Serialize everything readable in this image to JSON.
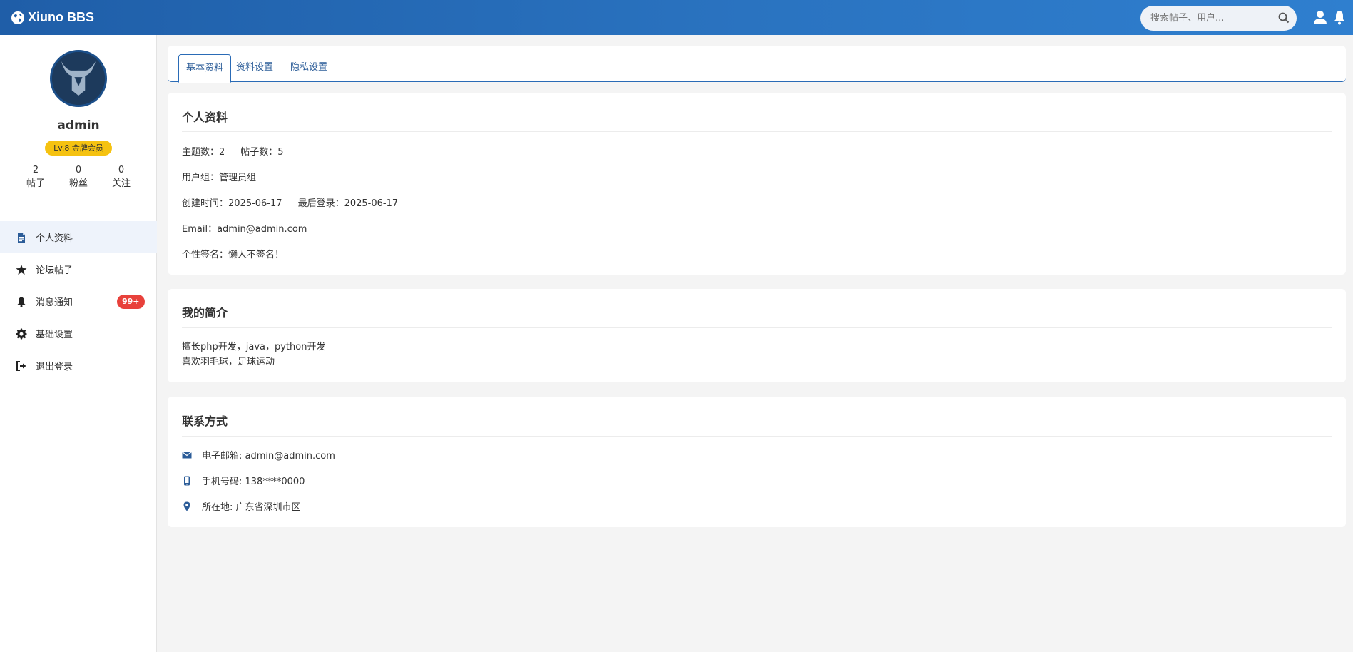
{
  "header": {
    "brand": "Xiuno BBS",
    "search_placeholder": "搜索帖子、用户..."
  },
  "profile": {
    "username": "admin",
    "level_badge": "Lv.8 金牌会员",
    "stats": [
      {
        "value": "2",
        "label": "帖子"
      },
      {
        "value": "0",
        "label": "粉丝"
      },
      {
        "value": "0",
        "label": "关注"
      }
    ]
  },
  "menu": {
    "items": [
      {
        "label": "个人资料",
        "icon": "document-icon",
        "active": true
      },
      {
        "label": "论坛帖子",
        "icon": "star-icon"
      },
      {
        "label": "消息通知",
        "icon": "bell-icon",
        "count": "99+"
      },
      {
        "label": "基础设置",
        "icon": "gear-icon"
      },
      {
        "label": "退出登录",
        "icon": "logout-icon"
      }
    ]
  },
  "tabs": [
    {
      "label": "基本资料",
      "active": true
    },
    {
      "label": "资料设置"
    },
    {
      "label": "隐私设置"
    }
  ],
  "personal_info": {
    "title": "个人资料",
    "topics": "主题数：2",
    "posts": "帖子数：5",
    "group": "用户组：管理员组",
    "created": "创建时间：2025-06-17",
    "last_login": "最后登录：2025-06-17",
    "email": "Email：admin@admin.com",
    "signature": "个性签名：懒人不签名！"
  },
  "intro": {
    "title": "我的简介",
    "line1": "擅长php开发，java，python开发",
    "line2": "喜欢羽毛球，足球运动"
  },
  "contact": {
    "title": "联系方式",
    "email": "电子邮箱: admin@admin.com",
    "phone": "手机号码: 138****0000",
    "location": "所在地: 广东省深圳市区"
  },
  "colors": {
    "header_start": "#1f5ea8",
    "header_end": "#2f7fcf",
    "accent": "#2a6bb6",
    "badge_gold": "#f5c211",
    "notify_red": "#e8413b"
  }
}
